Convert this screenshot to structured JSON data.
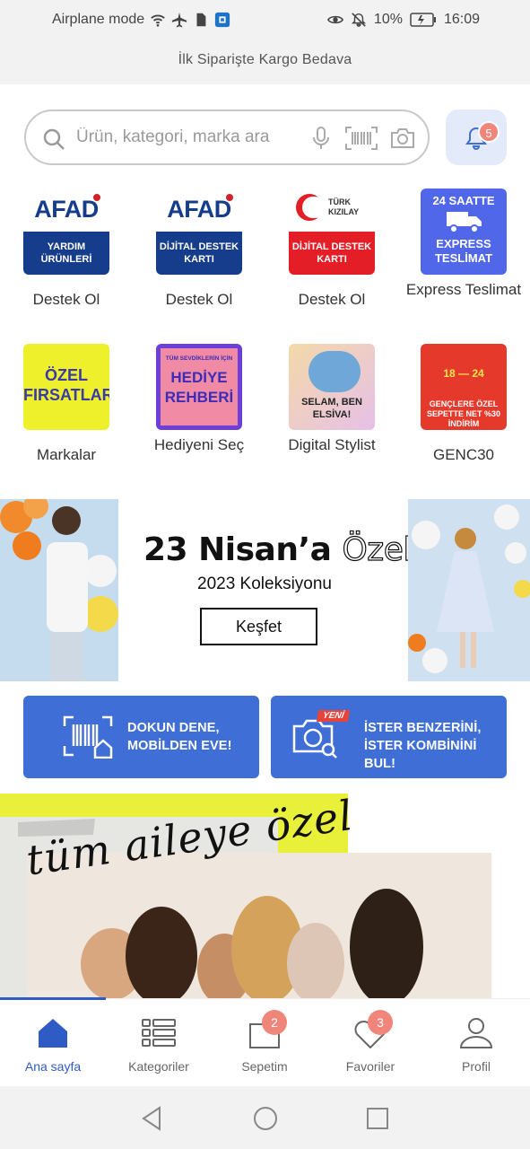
{
  "status_bar": {
    "mode": "Airplane mode",
    "battery": "10%",
    "time": "16:09"
  },
  "announcement": "İlk Siparişte Kargo Bedava",
  "search": {
    "placeholder": "Ürün, kategori, marka ara",
    "icons": [
      "search-icon",
      "microphone-icon",
      "barcode-icon",
      "camera-icon"
    ]
  },
  "notifications": {
    "count": "5"
  },
  "shortcuts": [
    {
      "label": "Destek Ol",
      "tile": {
        "logo": "AFAD",
        "band": "YARDIM ÜRÜNLERİ"
      }
    },
    {
      "label": "Destek Ol",
      "tile": {
        "logo": "AFAD",
        "band": "DİJİTAL DESTEK KARTI"
      }
    },
    {
      "label": "Destek Ol",
      "tile": {
        "logo": "TÜRK KIZILAY",
        "band": "DİJİTAL DESTEK KARTI"
      }
    },
    {
      "label": "Express Teslimat",
      "tile": {
        "top": "24 SAATTE",
        "bottom": "EXPRESS TESLİMAT"
      }
    },
    {
      "label": "Markalar",
      "tile": {
        "text": "ÖZEL FIRSATLAR"
      }
    },
    {
      "label": "Hediyeni Seç",
      "tile": {
        "small": "TÜM SEVDİKLERİN İÇİN",
        "big": "HEDİYE REHBERİ"
      }
    },
    {
      "label": "Digital Stylist",
      "tile": {
        "text": "SELAM, BEN ELSİVA!"
      }
    },
    {
      "label": "GENC30",
      "tile": {
        "num": "18 — 24",
        "text": "GENÇLERE ÖZEL SEPETTE NET %30 İNDİRİM"
      }
    }
  ],
  "banner": {
    "title_main": "23 Nisan’a",
    "title_outline": "Özel",
    "subtitle": "2023 Koleksiyonu",
    "cta": "Keşfet"
  },
  "feature_buttons": [
    {
      "line1": "DOKUN DENE,",
      "line2": "MOBİLDEN EVE!"
    },
    {
      "badge": "YENİ",
      "line1": "İSTER BENZERİNİ,",
      "line2": "İSTER KOMBİNİNİ BUL!"
    }
  ],
  "promo": {
    "script_text": "tüm aileye özel"
  },
  "bottom_nav": [
    {
      "label": "Ana sayfa",
      "icon": "home-icon",
      "active": true
    },
    {
      "label": "Kategoriler",
      "icon": "list-icon"
    },
    {
      "label": "Sepetim",
      "icon": "bag-icon",
      "badge": "2"
    },
    {
      "label": "Favoriler",
      "icon": "heart-icon",
      "badge": "3"
    },
    {
      "label": "Profil",
      "icon": "user-icon"
    }
  ],
  "colors": {
    "primary": "#3e6ed6",
    "badge": "#f0857a",
    "active_nav": "#2f5bc5"
  }
}
